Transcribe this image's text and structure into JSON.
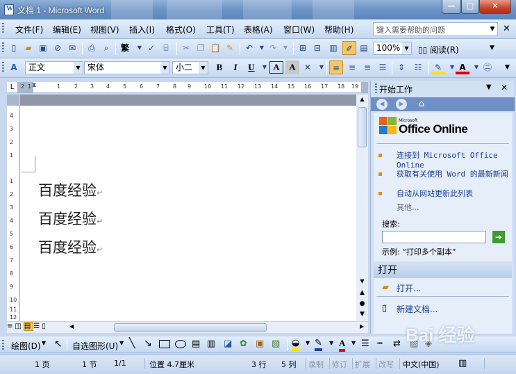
{
  "window": {
    "title": "文档 1 - Microsoft Word",
    "min": "—",
    "max": "□",
    "close": "✕"
  },
  "menu": {
    "items": [
      "文件(F)",
      "编辑(E)",
      "视图(V)",
      "插入(I)",
      "格式(O)",
      "工具(T)",
      "表格(A)",
      "窗口(W)",
      "帮助(H)"
    ],
    "help_placeholder": "键入需要帮助的问题"
  },
  "standard_toolbar": {
    "zoom": "100%",
    "read": "阅读(R)"
  },
  "format_toolbar": {
    "style": "正文",
    "font": "宋体",
    "size": "小二",
    "bold": "B",
    "italic": "I",
    "underline": "U",
    "char_border": "A",
    "char_shading": "A"
  },
  "ruler": {
    "h_ticks": [
      "2",
      "1",
      "1",
      "2",
      "3",
      "4",
      "5",
      "6",
      "7",
      "8",
      "9",
      "10",
      "11",
      "12",
      "13",
      "14",
      "15",
      "16",
      "17",
      "18",
      "19"
    ],
    "v_ticks": [
      "4",
      "3",
      "2",
      "1",
      "1",
      "2",
      "3",
      "4",
      "5",
      "6",
      "7",
      "8",
      "9",
      "10",
      "11",
      "12"
    ]
  },
  "document": {
    "lines": [
      "百度经验",
      "百度经验",
      "百度经验"
    ],
    "para_mark": "↵"
  },
  "task_pane": {
    "title": "开始工作",
    "brand_small": "Microsoft",
    "brand": "Office Online",
    "links": [
      "连接到 Microsoft Office Online",
      "获取有关使用 Word 的最新新闻",
      "自动从网站更新此列表"
    ],
    "more": "其他...",
    "search_label": "搜索:",
    "example": "示例:  “打印多个副本”",
    "open_section": "打开",
    "open_link": "打开...",
    "new_doc": "新建文档..."
  },
  "drawing_toolbar": {
    "draw": "绘图(D)",
    "autoshapes": "自选图形(U)"
  },
  "status": {
    "page": "1 页",
    "section": "1 节",
    "pages": "1/1",
    "position": "位置 4.7厘米",
    "line": "3 行",
    "col": "5 列",
    "rec": "录制",
    "trk": "修订",
    "ext": "扩展",
    "ovr": "改写",
    "lang": "中文(中国)"
  },
  "watermark": "Bai 经验"
}
